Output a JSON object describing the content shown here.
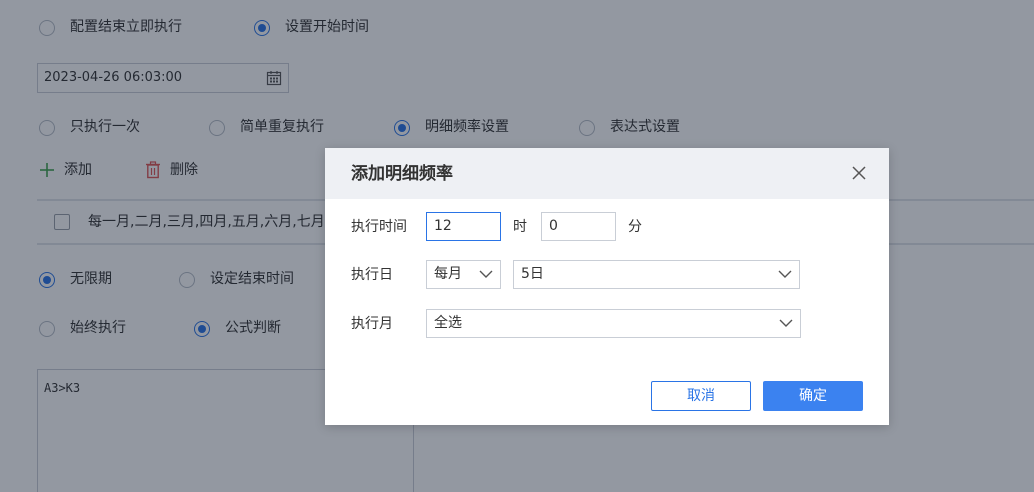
{
  "background": {
    "trigger": {
      "options": [
        {
          "label": "配置结束立即执行",
          "checked": false
        },
        {
          "label": "设置开始时间",
          "checked": true
        }
      ]
    },
    "start_time": "2023-04-26 06:03:00",
    "frequency": {
      "options": [
        {
          "label": "只执行一次",
          "checked": false
        },
        {
          "label": "简单重复执行",
          "checked": false
        },
        {
          "label": "明细频率设置",
          "checked": true
        },
        {
          "label": "表达式设置",
          "checked": false
        }
      ]
    },
    "toolbar": {
      "add_label": "添加",
      "delete_label": "删除"
    },
    "list_row_text": "每一月,二月,三月,四月,五月,六月,七月",
    "end": {
      "options": [
        {
          "label": "无限期",
          "checked": true
        },
        {
          "label": "设定结束时间",
          "checked": false
        }
      ]
    },
    "condition": {
      "options": [
        {
          "label": "始终执行",
          "checked": false
        },
        {
          "label": "公式判断",
          "checked": true
        }
      ]
    },
    "formula": "A3>K3"
  },
  "dialog": {
    "title": "添加明细频率",
    "exec_time": {
      "label": "执行时间",
      "hour": "12",
      "hour_unit": "时",
      "minute": "0",
      "minute_unit": "分"
    },
    "exec_day": {
      "label": "执行日",
      "period": "每月",
      "day": "5日"
    },
    "exec_month": {
      "label": "执行月",
      "value": "全选"
    },
    "cancel_label": "取消",
    "ok_label": "确定"
  },
  "colors": {
    "accent": "#2a74e6",
    "primary_button": "#3b82f0",
    "delete_icon": "#e05555",
    "add_icon": "#3fa34d"
  }
}
